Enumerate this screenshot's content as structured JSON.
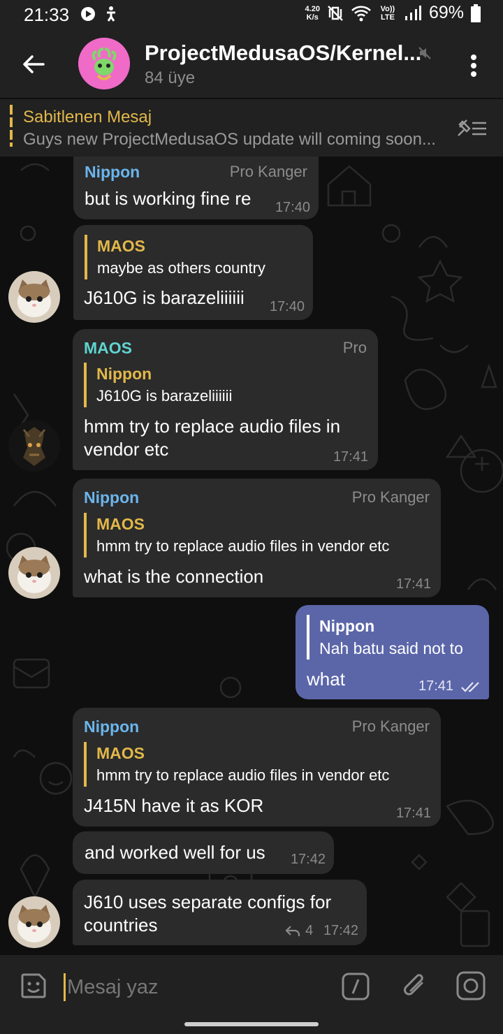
{
  "status_bar": {
    "time": "21:33",
    "speed": "4.20",
    "speed_unit": "K/s",
    "volte": "Vo)) LTE",
    "battery": "69%"
  },
  "header": {
    "title": "ProjectMedusaOS/Kernel...",
    "members": "84 üye",
    "avatar_color": "#f06ac8"
  },
  "pinned": {
    "label": "Sabitlenen Mesaj",
    "text": "Guys new ProjectMedusaOS update will coming soon..."
  },
  "messages": [
    {
      "sender": "Nippon",
      "role": "Pro Kanger",
      "text": "but is working fine re",
      "time": "17:40"
    },
    {
      "reply_to": "MAOS",
      "reply_text": "maybe as others country",
      "text": "J610G is barazeliiiiii",
      "time": "17:40"
    },
    {
      "sender": "MAOS",
      "role": "Pro",
      "reply_to": "Nippon",
      "reply_text": "J610G is barazeliiiiii",
      "text_line1": "hmm try to replace audio files in",
      "text_line2": "vendor etc",
      "time": "17:41"
    },
    {
      "sender": "Nippon",
      "role": "Pro Kanger",
      "reply_to": "MAOS",
      "reply_text": "hmm try to replace audio files in vendor etc",
      "text": "what is the connection",
      "time": "17:41"
    },
    {
      "outgoing": true,
      "reply_to": "Nippon",
      "reply_text": "Nah batu said not to",
      "text": "what",
      "time": "17:41"
    },
    {
      "sender": "Nippon",
      "role": "Pro Kanger",
      "reply_to": "MAOS",
      "reply_text": "hmm try to replace audio files in vendor etc",
      "text": "J415N have it as KOR",
      "time": "17:41"
    },
    {
      "text": "and worked well for us",
      "time": "17:42"
    },
    {
      "text_line1": "J610 uses separate configs for",
      "text_line2": "countries",
      "reply_count": "4",
      "time": "17:42"
    }
  ],
  "input": {
    "placeholder": "Mesaj yaz"
  },
  "colors": {
    "accent": "#e2b84a",
    "name_blue": "#6bb5ec",
    "name_teal": "#5fd4cf",
    "outgoing_bubble": "#5b66a9",
    "incoming_bubble": "#2b2b2b"
  }
}
